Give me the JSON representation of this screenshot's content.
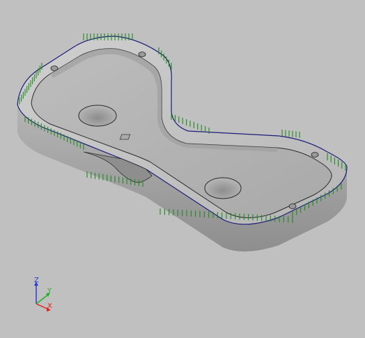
{
  "viewport": {
    "background": "#c0c0c0"
  },
  "model": {
    "body_color": "#b9b9b9",
    "top_color": "#c2c2c2",
    "side_color": "#9e9e9e",
    "edge_color": "#1c1c7a",
    "toolpath_color": "#1f8a1f",
    "hole_color": "#a8a8a8"
  },
  "triad": {
    "x_label": "X",
    "y_label": "Y",
    "z_label": "Z",
    "x_color": "#e0241a",
    "y_color": "#23b123",
    "z_color": "#2a3ad0"
  }
}
